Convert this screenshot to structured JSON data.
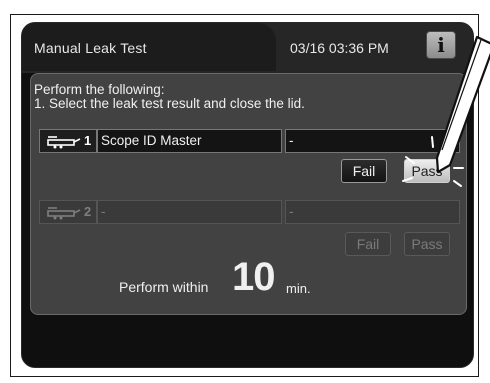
{
  "header": {
    "title": "Manual Leak Test",
    "datetime": "03/16 03:36 PM",
    "info_label": "i"
  },
  "instructions": {
    "line1": "Perform the following:",
    "line2": "1. Select the leak test result and close the lid."
  },
  "rows": [
    {
      "number": "1",
      "scope_id": "Scope ID Master",
      "second_field": "-",
      "fail_label": "Fail",
      "pass_label": "Pass",
      "enabled": true
    },
    {
      "number": "2",
      "scope_id": "-",
      "second_field": "-",
      "fail_label": "Fail",
      "pass_label": "Pass",
      "enabled": false
    }
  ],
  "footer": {
    "prefix": "Perform within",
    "value": "10",
    "unit": "min."
  },
  "colors": {
    "screen_bg": "#0f0f0f",
    "panel_bg": "#424242",
    "text": "#f0f0f0",
    "disabled_text": "#7e7e7e"
  },
  "icons": [
    "scope-icon",
    "info-icon",
    "stylus-icon",
    "tap-highlight-icon"
  ]
}
